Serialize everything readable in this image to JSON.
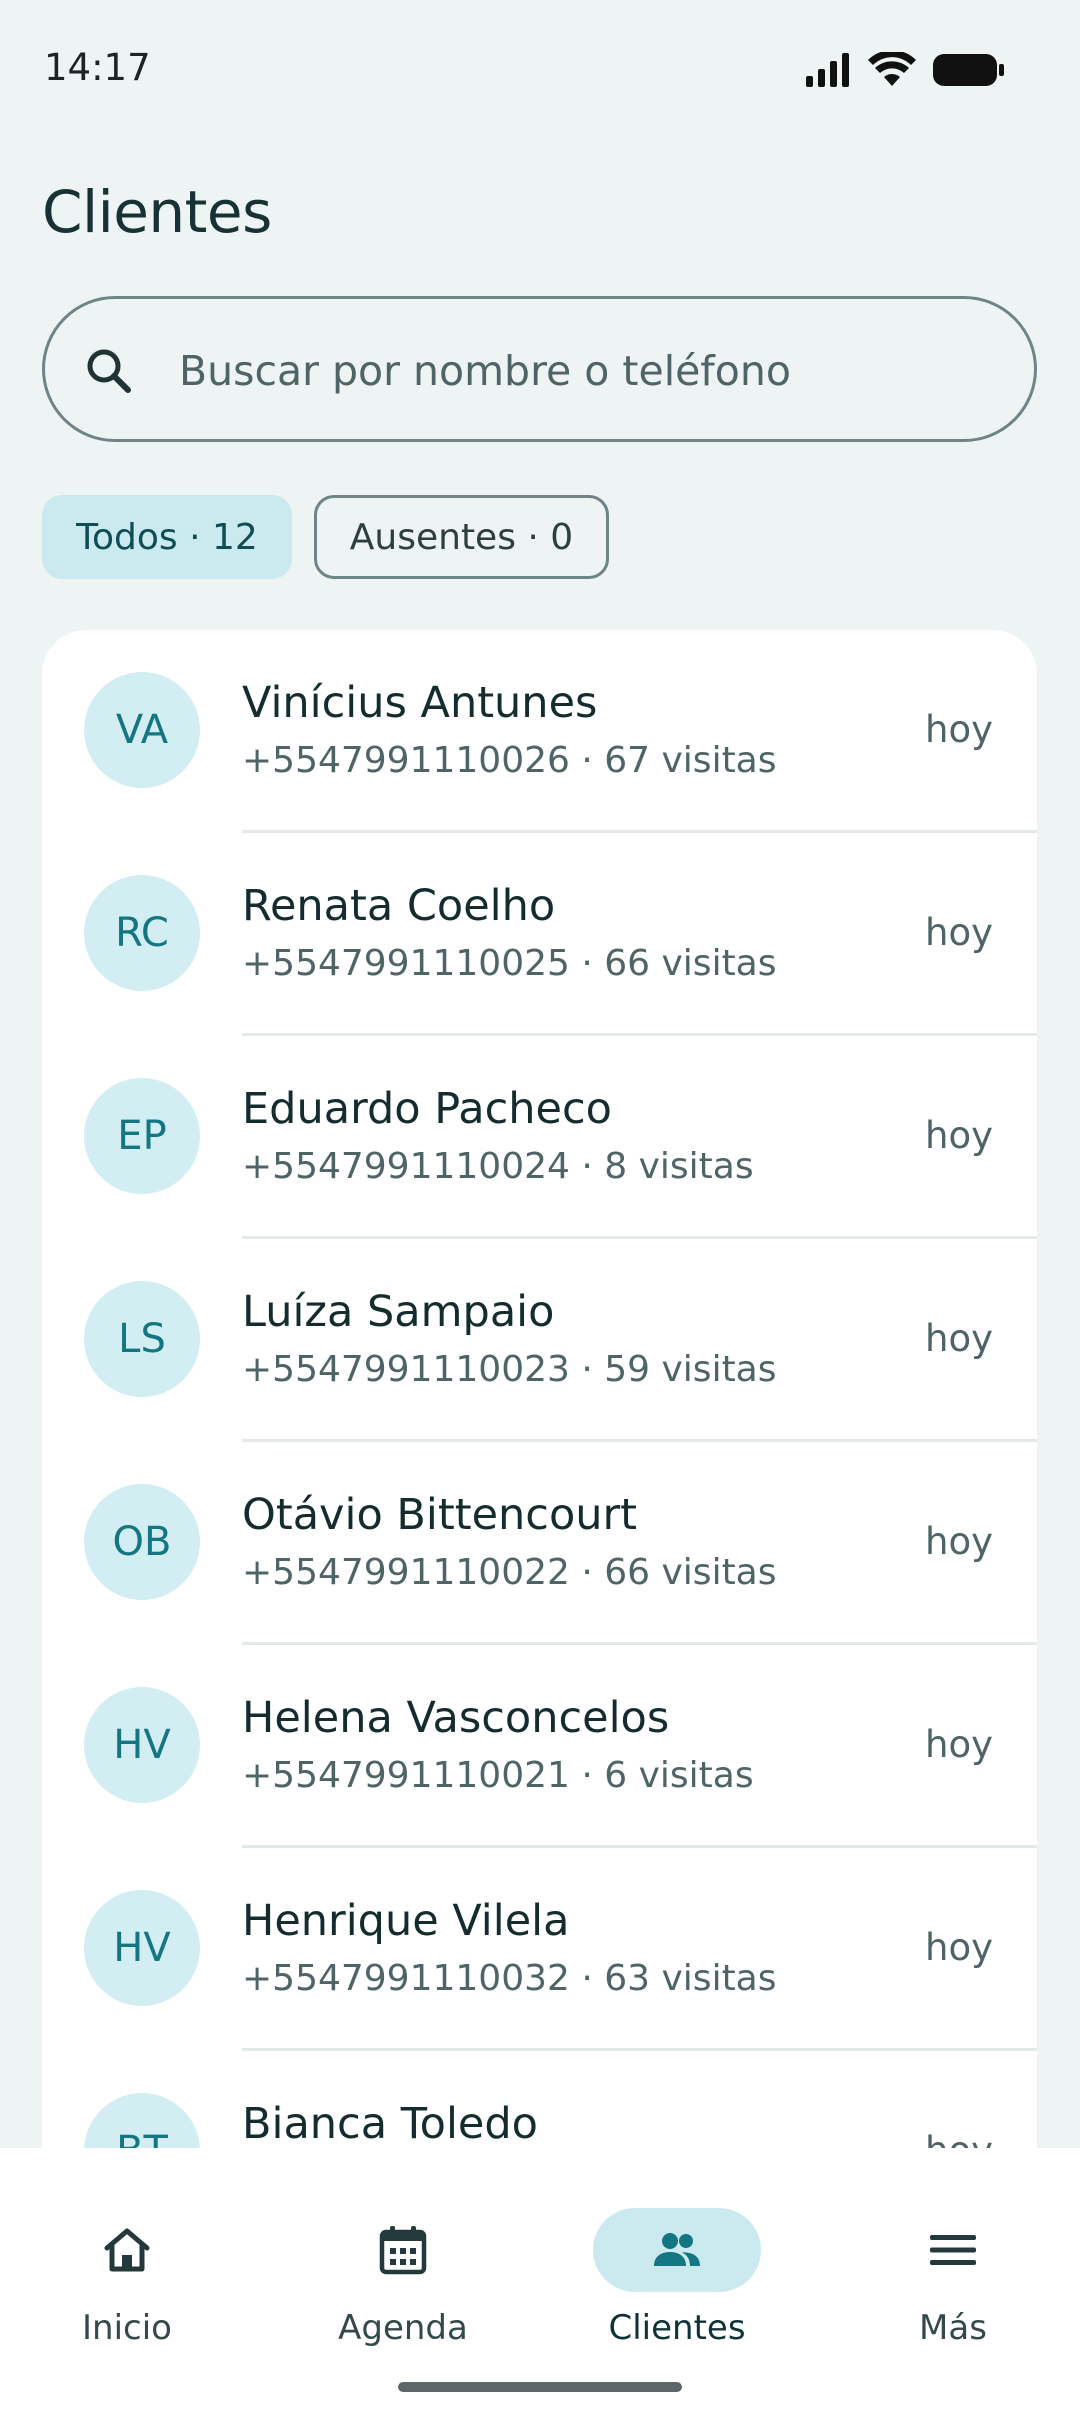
{
  "status_bar": {
    "time": "14:17",
    "icons": [
      "cellular-signal-icon",
      "wifi-icon",
      "battery-icon"
    ]
  },
  "header": {
    "title": "Clientes"
  },
  "search": {
    "icon": "search-icon",
    "placeholder": "Buscar por nombre o teléfono"
  },
  "filters": [
    {
      "label": "Todos · 12",
      "selected": true
    },
    {
      "label": "Ausentes · 0",
      "selected": false
    }
  ],
  "clients": [
    {
      "initials": "VA",
      "name": "Vinícius Antunes",
      "meta": "+5547991110026 · 67 visitas",
      "when": "hoy"
    },
    {
      "initials": "RC",
      "name": "Renata Coelho",
      "meta": "+5547991110025 · 66 visitas",
      "when": "hoy"
    },
    {
      "initials": "EP",
      "name": "Eduardo Pacheco",
      "meta": "+5547991110024 · 8 visitas",
      "when": "hoy"
    },
    {
      "initials": "LS",
      "name": "Luíza Sampaio",
      "meta": "+5547991110023 · 59 visitas",
      "when": "hoy"
    },
    {
      "initials": "OB",
      "name": "Otávio Bittencourt",
      "meta": "+5547991110022 · 66 visitas",
      "when": "hoy"
    },
    {
      "initials": "HV",
      "name": "Helena Vasconcelos",
      "meta": "+5547991110021 · 6 visitas",
      "when": "hoy"
    },
    {
      "initials": "HV",
      "name": "Henrique Vilela",
      "meta": "+5547991110032 · 63 visitas",
      "when": "hoy"
    },
    {
      "initials": "BT",
      "name": "Bianca Toledo",
      "meta": "",
      "when": "hoy"
    }
  ],
  "bottom_nav": [
    {
      "label": "Inicio",
      "icon": "home-icon",
      "active": false
    },
    {
      "label": "Agenda",
      "icon": "calendar-icon",
      "active": false
    },
    {
      "label": "Clientes",
      "icon": "people-icon",
      "active": true
    },
    {
      "label": "Más",
      "icon": "menu-icon",
      "active": false
    }
  ],
  "colors": {
    "background": "#eef3f4",
    "accent": "#137682",
    "chip_selected": "#cbeaf0",
    "avatar_bg": "#d2eef2"
  }
}
